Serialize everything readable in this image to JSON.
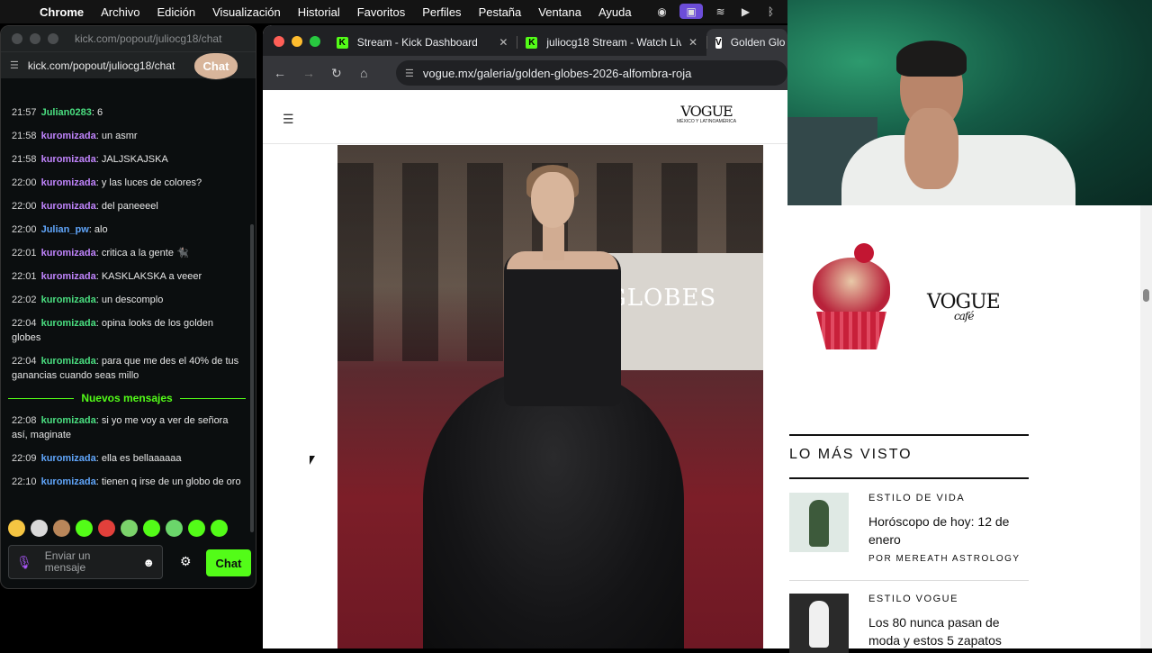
{
  "menubar": {
    "app": "Chrome",
    "items": [
      "Archivo",
      "Edición",
      "Visualización",
      "Historial",
      "Favoritos",
      "Perfiles",
      "Pestaña",
      "Ventana",
      "Ayuda"
    ]
  },
  "chat_window": {
    "title": "kick.com/popout/juliocg18/chat",
    "url": "kick.com/popout/juliocg18/chat",
    "header": "Chat",
    "messages": [
      {
        "time": "21:57",
        "user": "Julian0283",
        "text": ": 6",
        "color": "#4ade80"
      },
      {
        "time": "21:58",
        "user": "kuromizada",
        "text": ": un asmr",
        "color": "#c084fc"
      },
      {
        "time": "21:58",
        "user": "kuromizada",
        "text": ": JALJSKAJSKA",
        "color": "#c084fc"
      },
      {
        "time": "22:00",
        "user": "kuromizada",
        "text": ": y las luces de colores?",
        "color": "#c084fc"
      },
      {
        "time": "22:00",
        "user": "kuromizada",
        "text": ": del paneeeel",
        "color": "#c084fc"
      },
      {
        "time": "22:00",
        "user": "Julian_pw",
        "text": ": alo",
        "color": "#60a5fa"
      },
      {
        "time": "22:01",
        "user": "kuromizada",
        "text": ": critica a la gente 🐈‍⬛",
        "color": "#c084fc"
      },
      {
        "time": "22:01",
        "user": "kuromizada",
        "text": ": KASKLAKSKA a veeer",
        "color": "#c084fc"
      },
      {
        "time": "22:02",
        "user": "kuromizada",
        "text": ": un descomplo",
        "color": "#4ade80"
      },
      {
        "time": "22:04",
        "user": "kuromizada",
        "text": ": opina looks de los golden globes",
        "color": "#4ade80"
      },
      {
        "time": "22:04",
        "user": "kuromizada",
        "text": ": para que me des el 40% de tus ganancias cuando seas millo",
        "color": "#4ade80"
      }
    ],
    "new_messages_label": "Nuevos mensajes",
    "new_messages": [
      {
        "time": "22:08",
        "user": "kuromizada",
        "text": ": si yo me voy a ver de señora así, maginate",
        "color": "#4ade80"
      },
      {
        "time": "22:09",
        "user": "kuromizada",
        "text": ": ella es bellaaaaaa",
        "color": "#60a5fa"
      },
      {
        "time": "22:10",
        "user": "kuromizada",
        "text": ": tienen q irse de un globo de oro",
        "color": "#60a5fa"
      }
    ],
    "emotes": [
      "#f5c542",
      "#d9d9d9",
      "#b9865a",
      "#53fc18",
      "#e2403b",
      "#7bd36b",
      "#53fc18",
      "#6bd66b",
      "#53fc18",
      "#53fc18"
    ],
    "input_placeholder": "Enviar un mensaje",
    "send_label": "Chat"
  },
  "browser": {
    "tabs": [
      {
        "label": "Stream - Kick Dashboard",
        "favicon": "K"
      },
      {
        "label": "juliocg18 Stream - Watch Live",
        "favicon": "K"
      },
      {
        "label": "Golden Glo",
        "favicon": "V",
        "active": true
      }
    ],
    "url": "vogue.mx/galeria/golden-globes-2026-alfombra-roja",
    "logo": "VOGUE",
    "logo_sub": "MÉXICO Y LATINOAMÉRICA",
    "photo_sign": "GLOBES"
  },
  "sidebar": {
    "ad_brand": "VOGUE",
    "ad_sub": "café",
    "most_viewed": "LO MÁS VISTO",
    "articles": [
      {
        "category": "ESTILO DE VIDA",
        "title": "Horóscopo de hoy: 12 de enero",
        "byline": "POR MEREATH ASTROLOGY"
      },
      {
        "category": "ESTILO VOGUE",
        "title": "Los 80 nunca pasan de moda y estos 5 zapatos",
        "byline": ""
      }
    ]
  }
}
